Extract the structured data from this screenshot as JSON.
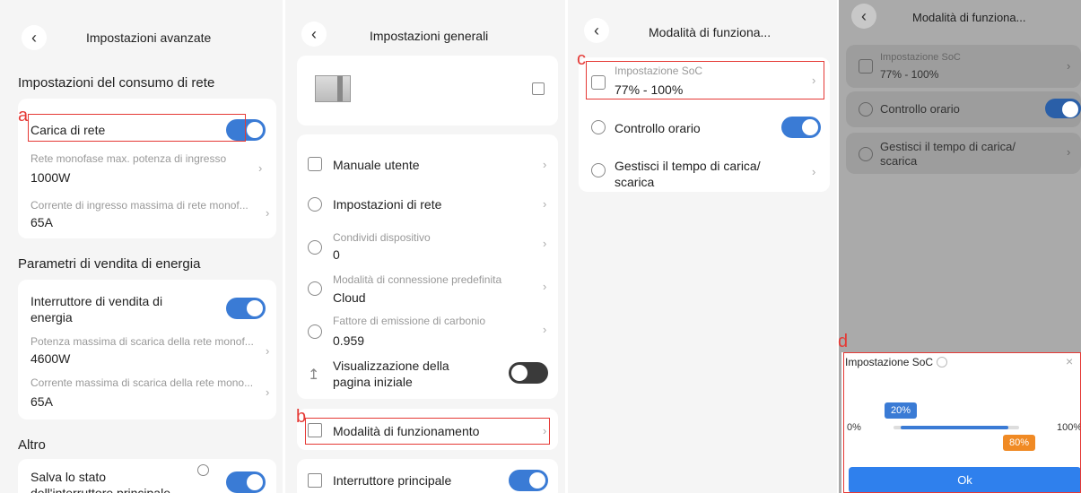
{
  "p1": {
    "title": "Impostazioni avanzate",
    "section1": "Impostazioni del consumo di rete",
    "carica_label": "Carica di rete",
    "mono_sub": "Rete monofase max. potenza di ingresso",
    "mono_val": "1000W",
    "corr_sub": "Corrente di ingresso massima di rete monof...",
    "corr_val": "65A",
    "section2": "Parametri di vendita di energia",
    "vendita_label_1": "Interruttore di vendita di",
    "vendita_label_2": "energia",
    "pot_sub": "Potenza massima di scarica della rete monof...",
    "pot_val": "4600W",
    "corrsc_sub": "Corrente massima di scarica della rete mono...",
    "corrsc_val": "65A",
    "section3": "Altro",
    "salva_1": "Salva lo stato",
    "salva_2": "dell'interruttore principale"
  },
  "p2": {
    "title": "Impostazioni generali",
    "manuale": "Manuale utente",
    "rete": "Impostazioni di rete",
    "condividi_sub": "Condividi dispositivo",
    "condividi_val": "0",
    "conn_sub": "Modalità di connessione predefinita",
    "conn_val": "Cloud",
    "fattore_sub": "Fattore di emissione di carbonio",
    "fattore_val": "0.959",
    "vis_1": "Visualizzazione della",
    "vis_2": "pagina iniziale",
    "modalita": "Modalità di funzionamento",
    "interruttore": "Interruttore principale"
  },
  "p3": {
    "title": "Modalità di funziona...",
    "soc_sub": "Impostazione SoC",
    "soc_val": "77% - 100%",
    "controllo": "Controllo orario",
    "gestisci_1": "Gestisci il tempo di carica/",
    "gestisci_2": "scarica"
  },
  "p4": {
    "title": "Modalità di funziona...",
    "soc_sub": "Impostazione SoC",
    "soc_val": "77% - 100%",
    "controllo": "Controllo orario",
    "gestisci_1": "Gestisci il tempo di carica/",
    "gestisci_2": "scarica",
    "sheet_title": "Impostazione SoC",
    "min_label": "0%",
    "max_label": "100%",
    "low_tip": "20%",
    "high_tip": "80%",
    "ok": "Ok",
    "slider_low_pct": 20,
    "slider_high_pct": 80
  },
  "markers": {
    "a": "a",
    "b": "b",
    "c": "c",
    "d": "d"
  },
  "colors": {
    "accent": "#3a7bd5",
    "marker": "#e53935",
    "orange": "#f08a24"
  }
}
